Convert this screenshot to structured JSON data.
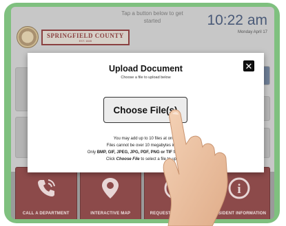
{
  "kiosk": {
    "prompt": "Tap a button below to get started",
    "clock_time": "10:22 am",
    "clock_date": "Monday April 17",
    "logo_name": "SPRINGFIELD COUNTY",
    "logo_est": "EST. 1845"
  },
  "tiles": [
    {
      "label": "CALL A DEPARTMENT",
      "icon": "phone-icon"
    },
    {
      "label": "INTERACTIVE MAP",
      "icon": "map-pin-icon"
    },
    {
      "label": "REQUEST ASSISTANCE",
      "icon": "question-icon"
    },
    {
      "label": "RESIDENT INFORMATION",
      "icon": "info-icon"
    }
  ],
  "modal": {
    "title": "Upload Document",
    "subtitle": "Choose a file to upload below",
    "close_label": "✕",
    "choose_button": "Choose File(s)",
    "line1": "You may add up to 10 files at once.",
    "line2": "Files cannot be over 10 megabytes in size.",
    "line3_prefix": "Only ",
    "line3_types": "BMP, GIF, JPEG, JPG, PDF, PNG or TIF",
    "line3_suffix": " files are allowed.",
    "line4_prefix": "Click ",
    "line4_em": "Choose File",
    "line4_suffix": " to select a file to upload."
  },
  "colors": {
    "frame": "#7fc07f",
    "tile": "#8c4a4a",
    "clock": "#4a5a78"
  }
}
